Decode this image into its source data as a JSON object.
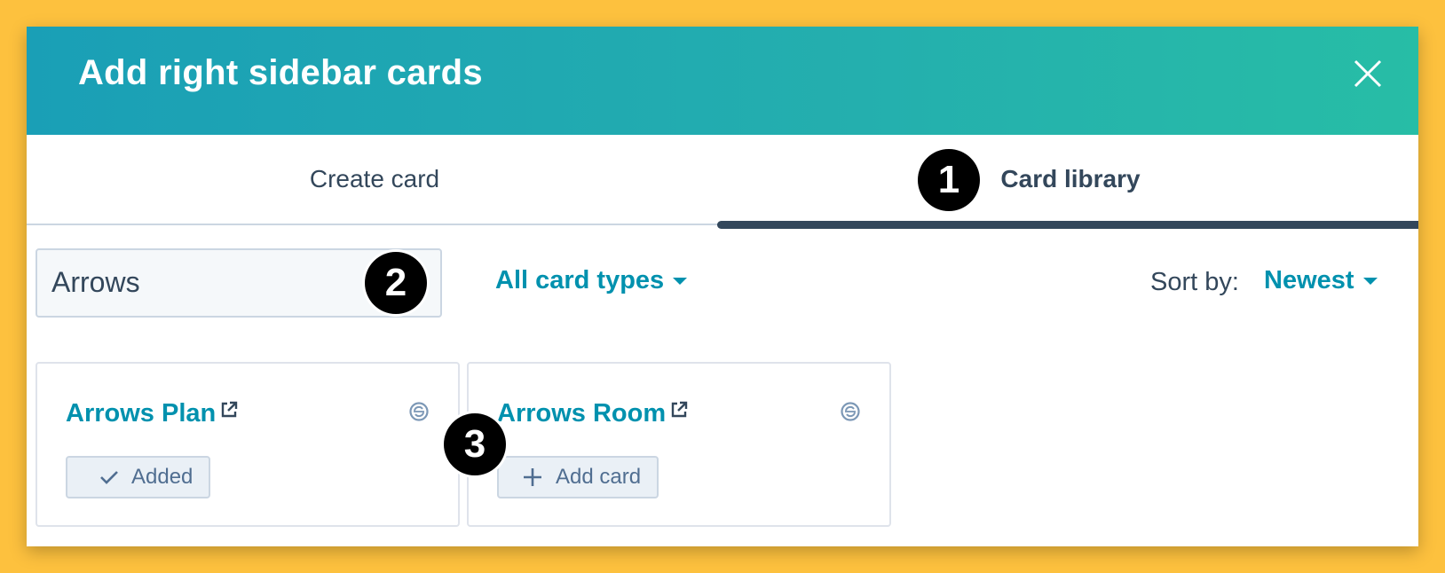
{
  "modal": {
    "title": "Add right sidebar cards"
  },
  "tabs": [
    {
      "label": "Create card"
    },
    {
      "label": "Card library"
    }
  ],
  "search": {
    "value": "Arrows"
  },
  "filter": {
    "label": "All card types"
  },
  "sort": {
    "label": "Sort by:",
    "value": "Newest"
  },
  "cards": [
    {
      "title": "Arrows Plan",
      "button": "Added"
    },
    {
      "title": "Arrows Room",
      "button": "Add card"
    }
  ],
  "badges": [
    "1",
    "2",
    "3"
  ],
  "colors": {
    "background": "#FDC13E",
    "header_start": "#1A9FB6",
    "header_end": "#27BDA6",
    "accent": "#0091AE",
    "text": "#33475B"
  },
  "icons": [
    "close-icon",
    "caret-down-icon",
    "external-link-icon",
    "sync-status-icon",
    "check-icon",
    "plus-icon"
  ]
}
